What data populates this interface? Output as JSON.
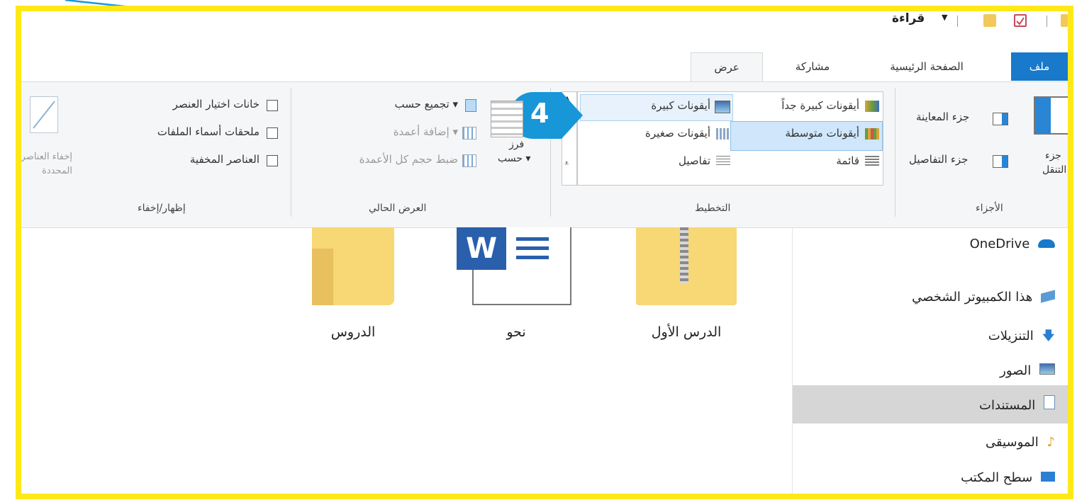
{
  "title_bar": {
    "title": "قراءة",
    "dropdown_symbol": "▼"
  },
  "tabs": [
    {
      "label": "ملف"
    },
    {
      "label": "الصفحة الرئيسية"
    },
    {
      "label": "مشاركة"
    },
    {
      "label": "عرض"
    }
  ],
  "callout": {
    "number": "4"
  },
  "ribbon": {
    "panes": {
      "nav_pane_label_1": "جزء",
      "nav_pane_label_2": "التنقل ▾",
      "preview_pane": "جزء المعاينة",
      "details_pane": "جزء التفاصيل",
      "group_label": "الأجزاء"
    },
    "layout": {
      "extra_large_icons": "أيقونات كبيرة جداً",
      "large_icons": "أيقونات كبيرة",
      "medium_icons": "أيقونات متوسطة",
      "small_icons": "أيقونات صغيرة",
      "list": "قائمة",
      "details": "تفاصيل",
      "group_label": "التخطيط"
    },
    "current_view": {
      "sort_by_1": "فرز",
      "sort_by_2": "حسب ▾",
      "group_by": "تجميع حسب ▾",
      "add_columns": "إضافة أعمدة ▾",
      "size_all_columns": "ضبط حجم كل الأعمدة",
      "group_label": "العرض الحالي"
    },
    "show_hide": {
      "item_checkboxes": "خانات اختيار العنصر",
      "file_extensions": "ملحقات أسماء الملفات",
      "hidden_items": "العناصر المخفية",
      "hide_selected_1": "إخفاء العناصر",
      "hide_selected_2": "المحددة",
      "group_label": "إظهار/إخفاء"
    }
  },
  "nav_pane": {
    "items": [
      {
        "label": "OneDrive"
      },
      {
        "label": "هذا الكمبيوتر الشخصي"
      },
      {
        "label": "التنزيلات"
      },
      {
        "label": "الصور"
      },
      {
        "label": "المستندات"
      },
      {
        "label": "الموسيقى"
      },
      {
        "label": "سطح المكتب"
      }
    ],
    "selected_index": 4
  },
  "files": [
    {
      "name": "الدرس الأول",
      "type": "zip-folder"
    },
    {
      "name": "نحو",
      "type": "word-document"
    },
    {
      "name": "الدروس",
      "type": "folder"
    }
  ],
  "colors": {
    "highlight_border": "#ffe818",
    "callout": "#1797d8",
    "file_tab": "#1979ca",
    "selection": "#cfe6fb",
    "folder": "#f8d775"
  }
}
